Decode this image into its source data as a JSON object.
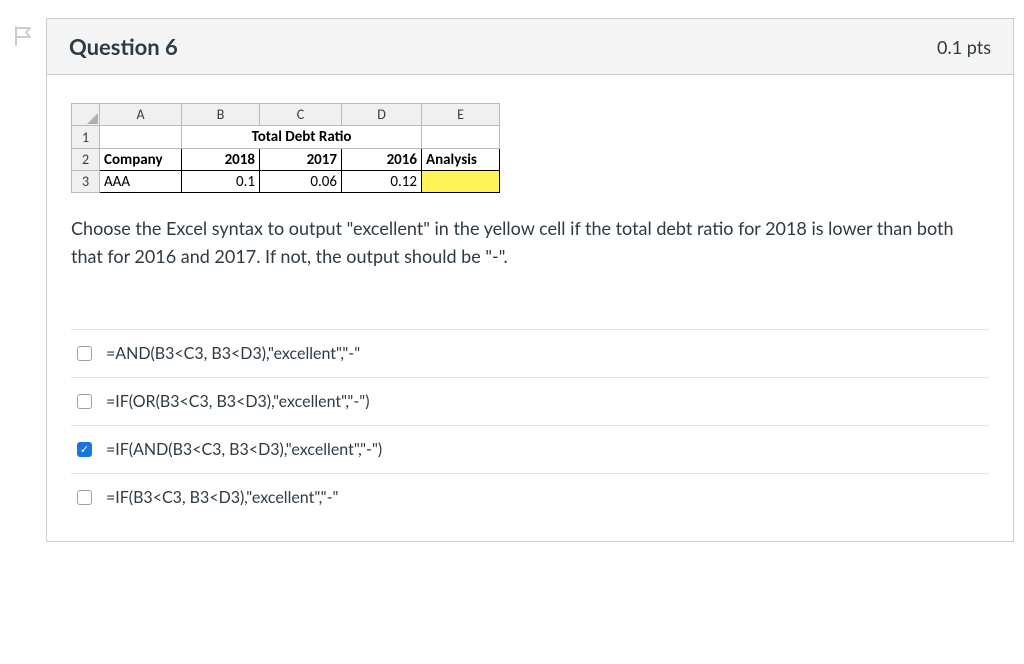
{
  "question": {
    "title": "Question 6",
    "points_label": "0.1 pts",
    "text": "Choose the Excel syntax to output \"excellent\" in the yellow cell if the total debt ratio for 2018 is lower than both that for 2016 and 2017. If not, the output should be \"-\"."
  },
  "spreadsheet": {
    "columns": [
      "A",
      "B",
      "C",
      "D",
      "E"
    ],
    "row_numbers": [
      "1",
      "2",
      "3"
    ],
    "merged_title": "Total Debt Ratio",
    "headers_row": {
      "company": "Company",
      "y2018": "2018",
      "y2017": "2017",
      "y2016": "2016",
      "analysis": "Analysis"
    },
    "data_row": {
      "company": "AAA",
      "y2018": "0.1",
      "y2017": "0.06",
      "y2016": "0.12",
      "analysis": ""
    }
  },
  "chart_data": {
    "type": "table",
    "title": "Total Debt Ratio",
    "columns": [
      "Company",
      "2018",
      "2017",
      "2016",
      "Analysis"
    ],
    "rows": [
      {
        "Company": "AAA",
        "2018": 0.1,
        "2017": 0.06,
        "2016": 0.12,
        "Analysis": ""
      }
    ]
  },
  "options": [
    {
      "label": "=AND(B3<C3, B3<D3),\"excellent\",\"-\"",
      "checked": false
    },
    {
      "label": "=IF(OR(B3<C3, B3<D3),\"excellent\",\"-\")",
      "checked": false
    },
    {
      "label": "=IF(AND(B3<C3, B3<D3),\"excellent\",\"-\")",
      "checked": true
    },
    {
      "label": "=IF(B3<C3, B3<D3),\"excellent\",\"-\"",
      "checked": false
    }
  ]
}
